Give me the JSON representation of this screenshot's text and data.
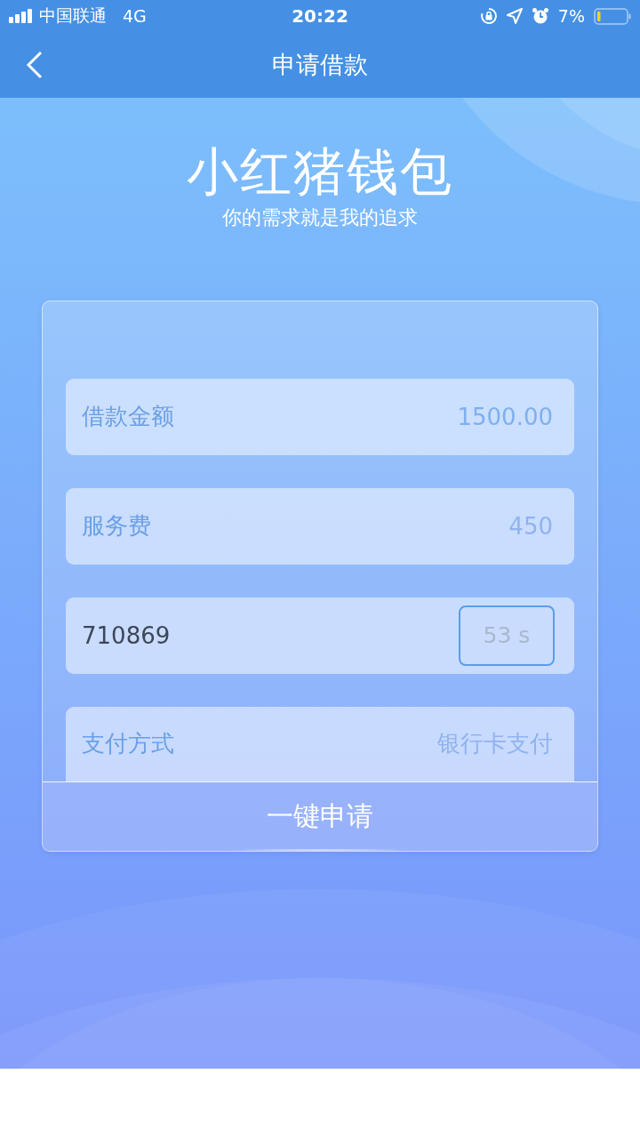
{
  "status_bar": {
    "carrier": "中国联通",
    "network": "4G",
    "time": "20:22",
    "battery": "7%"
  },
  "nav": {
    "title": "申请借款"
  },
  "hero": {
    "title": "小红猪钱包",
    "subtitle": "你的需求就是我的追求"
  },
  "form": {
    "rows": [
      {
        "kind": "field",
        "label": "借款金额",
        "value": "1500.00"
      },
      {
        "kind": "field",
        "label": "服务费",
        "placeholder": "450"
      },
      {
        "kind": "code",
        "value": "710869",
        "countdown": "53 s"
      },
      {
        "kind": "field",
        "label": "支付方式",
        "placeholder": "银行卡支付"
      }
    ],
    "submit": "一键申请"
  }
}
